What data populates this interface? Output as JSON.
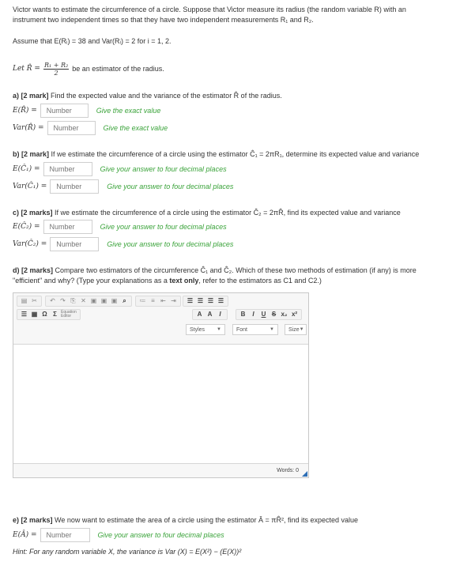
{
  "intro": {
    "line1": "Victor wants to estimate the circumference of a circle. Suppose that Victor measure its radius (the random variable R) with an",
    "line2": "instrument two independent times so that they have two independent measurements R₁ and R₂.",
    "assume": "Assume that E(Rᵢ) = 38 and Var(Rᵢ) = 2 for i = 1, 2.",
    "let_prefix": "Let R̂ =",
    "let_frac_num": "R₁ + R₂",
    "let_frac_den": "2",
    "let_suffix": "be an estimator of the radius."
  },
  "part_a": {
    "heading_bold": "a) [2 mark]",
    "heading_text": "Find the expected value and the variance of the estimator R̂ of the radius.",
    "rows": [
      {
        "label": "E(R̂) =",
        "placeholder": "Number",
        "hint": "Give the exact value"
      },
      {
        "label": "Var(R̂) =",
        "placeholder": "Number",
        "hint": "Give the exact value"
      }
    ]
  },
  "part_b": {
    "heading_bold": "b) [2 mark]",
    "heading_text": "If we estimate the circumference of a circle using the estimator Ĉ₁ = 2πR₁, determine its expected value and variance",
    "rows": [
      {
        "label": "E(Ĉ₁) =",
        "placeholder": "Number",
        "hint": "Give your answer to four decimal places"
      },
      {
        "label": "Var(Ĉ₁) =",
        "placeholder": "Number",
        "hint": "Give your answer to four decimal places"
      }
    ]
  },
  "part_c": {
    "heading_bold": "c) [2 marks]",
    "heading_text": "If we estimate the circumference of a circle using the estimator Ĉ₂ = 2πR̂, find its expected value and variance",
    "rows": [
      {
        "label": "E(Ĉ₂) =",
        "placeholder": "Number",
        "hint": "Give your answer to four decimal places"
      },
      {
        "label": "Var(Ĉ₂) =",
        "placeholder": "Number",
        "hint": "Give your answer to four decimal places"
      }
    ]
  },
  "part_d": {
    "heading_bold": "d) [2 marks]",
    "line1": "Compare two estimators of the circumference Ĉ₁ and Ĉ₂. Which of these two methods of estimation (if any) is more",
    "line2_pre": "\"efficient\" and why? (Type your explanations as a ",
    "line2_bold": "text only",
    "line2_post": ", refer to the estimators as C1 and C2.)"
  },
  "editor": {
    "equation_editor_label": "Equation Editor",
    "styles_label": "Styles",
    "font_label": "Font",
    "size_label": "Size",
    "word_count": "Words: 0"
  },
  "part_e": {
    "heading_bold": "e) [2 marks]",
    "heading_text": "We now want to estimate the area of a circle using the estimator Â = πR̂², find its expected value",
    "rows": [
      {
        "label": "E(Â) =",
        "placeholder": "Number",
        "hint": "Give your answer to four decimal places"
      }
    ],
    "hint_line": "Hint: For any random variable X, the variance is Var (X) = E(X²) − (E(X))²"
  }
}
